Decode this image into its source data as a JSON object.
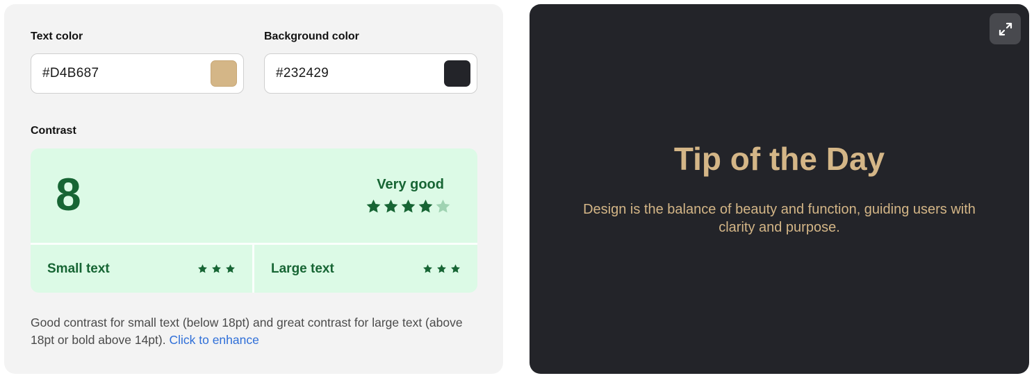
{
  "text_color": {
    "label": "Text color",
    "value": "#D4B687",
    "swatch": "#D4B687"
  },
  "background_color": {
    "label": "Background color",
    "value": "#232429",
    "swatch": "#232429"
  },
  "contrast": {
    "label": "Contrast",
    "score": "8",
    "rating": "Very good",
    "rating_stars": 4,
    "rating_stars_max": 5,
    "small_text": {
      "label": "Small text",
      "stars": 3
    },
    "large_text": {
      "label": "Large text",
      "stars": 3
    },
    "description": "Good contrast for small text (below 18pt) and great contrast for large text (above 18pt or bold above 14pt).",
    "enhance_link": "Click to enhance"
  },
  "preview": {
    "title": "Tip of the Day",
    "body": "Design is the balance of beauty and function, guiding users with clarity and purpose.",
    "expand_icon": "expand-icon"
  },
  "colors": {
    "panel_bg": "#f3f3f3",
    "success_bg": "#dcfae6",
    "success_fg": "#176534",
    "star_off": "#9fd3b2",
    "link": "#2f6fd8"
  }
}
